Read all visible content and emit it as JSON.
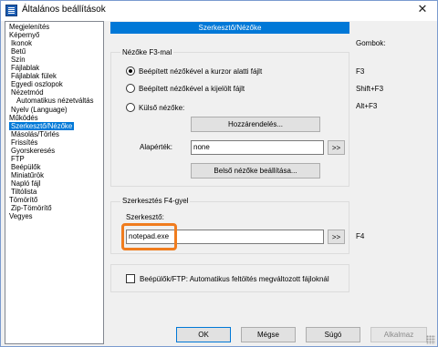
{
  "window": {
    "title": "Általános beállítások",
    "close_glyph": "✕"
  },
  "tree": {
    "items": [
      {
        "label": "Megjelenítés",
        "level": 0
      },
      {
        "label": "Képernyő",
        "level": 0
      },
      {
        "label": "Ikonok",
        "level": 1
      },
      {
        "label": "Betű",
        "level": 1
      },
      {
        "label": "Szín",
        "level": 1
      },
      {
        "label": "Fájlablak",
        "level": 1
      },
      {
        "label": "Fájlablak fülek",
        "level": 1
      },
      {
        "label": "Egyedi oszlopok",
        "level": 1
      },
      {
        "label": "Nézetmód",
        "level": 1
      },
      {
        "label": "Automatikus nézetváltás",
        "level": 2
      },
      {
        "label": "Nyelv (Language)",
        "level": 1
      },
      {
        "label": "Működés",
        "level": 0
      },
      {
        "label": "Szerkesztő/Nézőke",
        "level": 1,
        "selected": true
      },
      {
        "label": "Másolás/Törlés",
        "level": 1
      },
      {
        "label": "Frissítés",
        "level": 1
      },
      {
        "label": "Gyorskeresés",
        "level": 1
      },
      {
        "label": "FTP",
        "level": 1
      },
      {
        "label": "Beépülők",
        "level": 1
      },
      {
        "label": "Miniatűrök",
        "level": 1
      },
      {
        "label": "Napló fájl",
        "level": 1
      },
      {
        "label": "Tiltólista",
        "level": 1
      },
      {
        "label": "Tömörítő",
        "level": 0
      },
      {
        "label": "Zip-Tömörítő",
        "level": 1
      },
      {
        "label": "Vegyes",
        "level": 0
      }
    ]
  },
  "panel": {
    "header": "Szerkesztő/Nézőke",
    "buttons_col_label": "Gombok:"
  },
  "viewer_group": {
    "title": "Nézőke F3-mal",
    "options": [
      {
        "label": "Beépített nézőkével a kurzor alatti fájlt",
        "selected": true,
        "shortcut": "F3"
      },
      {
        "label": "Beépített nézőkével a kijelölt fájlt",
        "selected": false,
        "shortcut": "Shift+F3"
      },
      {
        "label": "Külső nézőke:",
        "selected": false,
        "shortcut": "Alt+F3"
      }
    ],
    "assign_button": "Hozzárendelés...",
    "default_label": "Alapérték:",
    "default_value": "none",
    "browse_button": ">>",
    "internal_settings_button": "Belső nézőke beállítása..."
  },
  "editor_group": {
    "title": "Szerkesztés F4-gyel",
    "editor_label": "Szerkesztő:",
    "editor_value": "notepad.exe",
    "browse_button": ">>",
    "shortcut": "F4"
  },
  "plugins_checkbox": {
    "label": "Beépülők/FTP: Automatikus feltöltés megváltozott fájloknál",
    "checked": false
  },
  "footer": {
    "ok": "OK",
    "cancel": "Mégse",
    "help": "Súgó",
    "apply": "Alkalmaz"
  },
  "colors": {
    "selection": "#0078d7",
    "highlight_frame": "#f07c1e"
  },
  "icons": {
    "app": "app-icon",
    "close": "close-icon"
  }
}
